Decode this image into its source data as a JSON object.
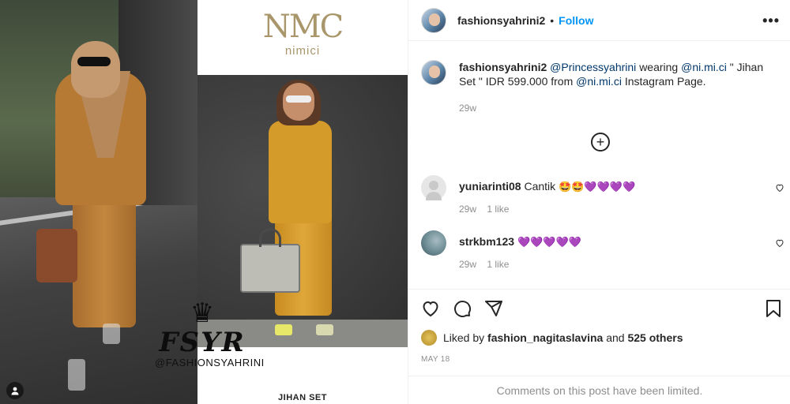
{
  "post": {
    "watermark": {
      "letters": "FSYR",
      "handle": "@FASHIONSYAHRINI"
    },
    "brand": {
      "logo": "NMC",
      "name": "nimici"
    },
    "product_label": "JIHAN SET"
  },
  "header": {
    "username": "fashionsyahrini2",
    "separator": "•",
    "follow_label": "Follow",
    "more_icon": "more-horizontal-icon"
  },
  "caption": {
    "username": "fashionsyahrini2",
    "mention1": "@Princessyahrini",
    "text1": "wearing",
    "mention2": "@ni.mi.ci",
    "text2": "\" Jihan Set \" IDR 599.000 from",
    "mention3": "@ni.mi.ci",
    "text3": "Instagram Page.",
    "time": "29w"
  },
  "load_more_icon": "plus-circle-icon",
  "comments": [
    {
      "username": "yuniarinti08",
      "text": "Cantik",
      "emojis": "🤩🤩💜💜💜💜",
      "time": "29w",
      "likes": "1 like"
    },
    {
      "username": "strkbm123",
      "text": "",
      "emojis": "💜💜💜💜💜",
      "time": "29w",
      "likes": "1 like"
    }
  ],
  "actions": {
    "like_icon": "heart-icon",
    "comment_icon": "comment-icon",
    "share_icon": "send-icon",
    "save_icon": "bookmark-icon"
  },
  "likes": {
    "prefix": "Liked by",
    "user": "fashion_nagitaslavina",
    "connector": "and",
    "others": "525 others"
  },
  "date": "MAY 18",
  "comments_limited": "Comments on this post have been limited.",
  "colors": {
    "link": "#0095f6",
    "mention": "#00376b",
    "muted": "#8e8e8e",
    "border": "#efefef"
  }
}
